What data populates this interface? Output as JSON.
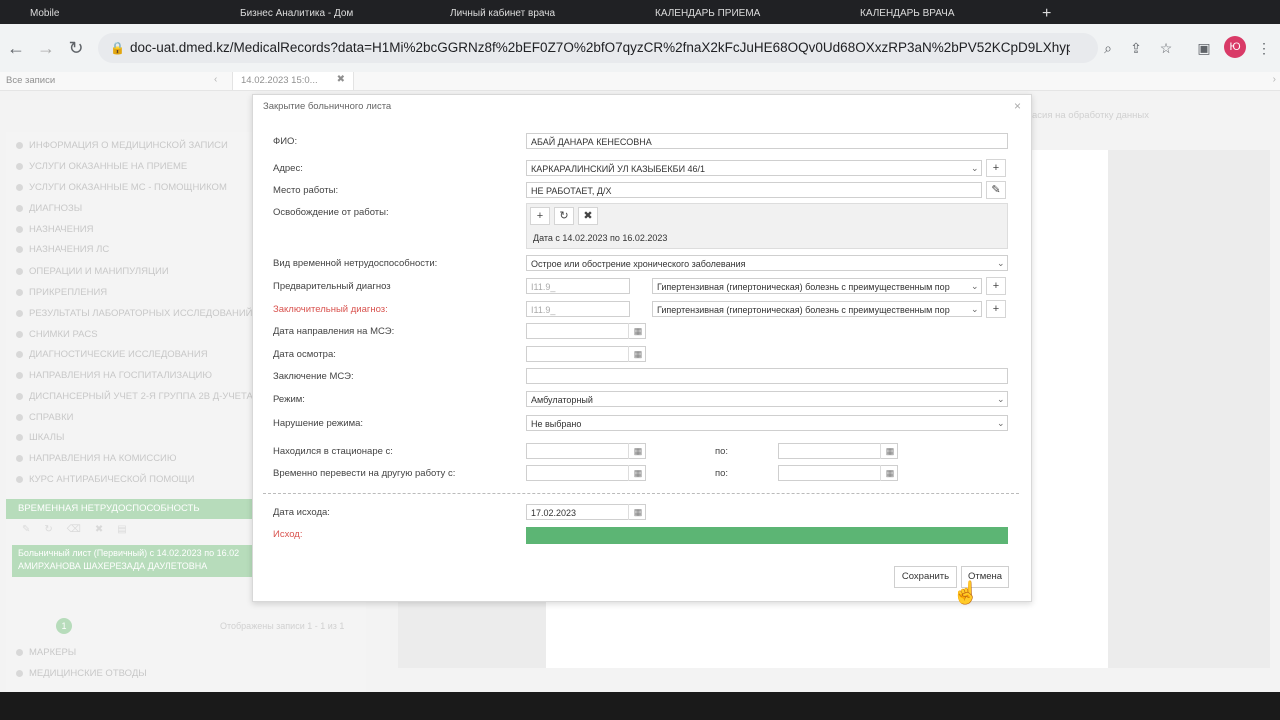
{
  "browser": {
    "tabs": [
      "Mobile",
      "Бизнес Аналитика - Дом",
      "Личный кабинет врача",
      "КАЛЕНДАРЬ ПРИЕМА",
      "КАЛЕНДАРЬ ВРАЧА"
    ],
    "url": "doc-uat.dmed.kz/MedicalRecords?data=H1Mi%2bcGGRNz8f%2bEF0Z7O%2bfO7qyzCR%2fnaX2kFcJuHE68OQv0Ud68OXxzRP3aN%2bPV52KCpD9LXhyp0DAAZIn%...",
    "profile_initial": "Ю"
  },
  "page": {
    "all_records": "Все записи",
    "record_tab": "14.02.2023 15:0...",
    "right_hint": "асия на обработку данных"
  },
  "sidebar": {
    "items": [
      "ИНФОРМАЦИЯ О МЕДИЦИНСКОЙ ЗАПИСИ",
      "УСЛУГИ ОКАЗАННЫЕ НА ПРИЕМЕ",
      "УСЛУГИ ОКАЗАННЫЕ МС - ПОМОЩНИКОМ",
      "ДИАГНОЗЫ",
      "НАЗНАЧЕНИЯ",
      "НАЗНАЧЕНИЯ ЛС",
      "ОПЕРАЦИИ И МАНИПУЛЯЦИИ",
      "ПРИКРЕПЛЕНИЯ",
      "РЕЗУЛЬТАТЫ ЛАБОРАТОРНЫХ ИССЛЕДОВАНИЙ",
      "СНИМКИ PACS",
      "ДИАГНОСТИЧЕСКИЕ ИССЛЕДОВАНИЯ",
      "НАПРАВЛЕНИЯ НА ГОСПИТАЛИЗАЦИЮ",
      "ДИСПАНСЕРНЫЙ УЧЕТ 2-Я ГРУППА 2В Д-УЧЕТА Ж",
      "СПРАВКИ",
      "ШКАЛЫ",
      "НАПРАВЛЕНИЯ НА КОМИССИЮ",
      "КУРС АНТИРАБИЧЕСКОЙ ПОМОЩИ"
    ],
    "active": "ВРЕМЕННАЯ НЕТРУДОСПОСОБНОСТЬ",
    "list_line1": "Больничный лист (Первичный) с 14.02.2023 по 16.02",
    "list_line2": "АМИРХАНОВА ШАХЕРЕЗАДА ДАУЛЕТОВНА",
    "pager_page": "1",
    "pager_info": "Отображены записи 1 - 1 из 1",
    "bottom_items": [
      "МАРКЕРЫ",
      "МЕДИЦИНСКИЕ ОТВОДЫ"
    ]
  },
  "modal": {
    "title": "Закрытие больничного листа",
    "labels": {
      "fio": "ФИО:",
      "address": "Адрес:",
      "workplace": "Место работы:",
      "release": "Освобождение от работы:",
      "type": "Вид временной нетрудоспособности:",
      "prelim": "Предварительный диагноз",
      "final": "Заключительный диагноз:",
      "mse_date": "Дата направления на МСЭ:",
      "exam_date": "Дата осмотра:",
      "mse_conclusion": "Заключение МСЭ:",
      "regime": "Режим:",
      "regime_violation": "Нарушение режима:",
      "hospital_from": "Находился в стационаре с:",
      "transfer_from": "Временно перевести на другую работу с:",
      "to": "по:",
      "outcome_date": "Дата исхода:",
      "outcome": "Исход:"
    },
    "values": {
      "fio": "АБАЙ ДАНАРА КЕНЕСОВНА",
      "address": "КАРКАРАЛИНСКИЙ УЛ КАЗЫБЕКБИ 46/1",
      "workplace": "НЕ РАБОТАЕТ, Д/Х",
      "release": "Дата с 14.02.2023 по 16.02.2023",
      "type": "Острое или обострение хронического заболевания",
      "prelim_code": "I11.9_",
      "prelim_name": "Гипертензивная (гипертоническая) болезнь с преимущественным пор",
      "final_code": "I11.9_",
      "final_name": "Гипертензивная (гипертоническая) болезнь с преимущественным пор",
      "regime": "Амбулаторный",
      "regime_violation": "Не выбрано",
      "outcome_date": "17.02.2023"
    },
    "buttons": {
      "save": "Сохранить",
      "cancel": "Отмена"
    }
  }
}
